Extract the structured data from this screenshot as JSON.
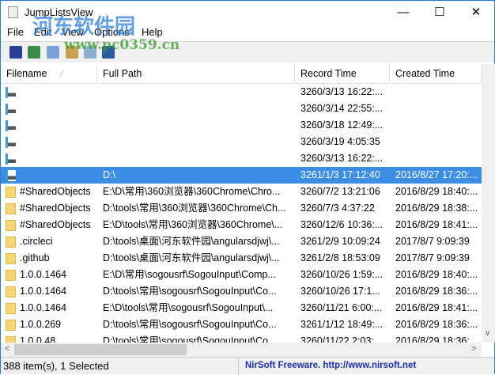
{
  "window": {
    "title": "JumpListsView",
    "minimize": "—",
    "maximize": "☐",
    "close": "✕"
  },
  "menu": [
    "File",
    "Edit",
    "View",
    "Options",
    "Help"
  ],
  "toolbar": [
    "save-icon",
    "refresh-icon",
    "copy-icon",
    "html-report-icon",
    "find-icon",
    "exit-icon"
  ],
  "columns": [
    "Filename",
    "Full Path",
    "Record Time",
    "Created Time"
  ],
  "rows": [
    {
      "type": "drive",
      "filename": "",
      "path": "",
      "record": "3260/3/13 16:22:...",
      "created": ""
    },
    {
      "type": "drive",
      "filename": "",
      "path": "",
      "record": "3260/3/14 22:55:...",
      "created": ""
    },
    {
      "type": "drive",
      "filename": "",
      "path": "",
      "record": "3260/3/18 12:49:...",
      "created": ""
    },
    {
      "type": "drive",
      "filename": "",
      "path": "",
      "record": "3260/3/19 4:05:35",
      "created": ""
    },
    {
      "type": "drive",
      "filename": "",
      "path": "",
      "record": "3260/3/13 16:22:...",
      "created": ""
    },
    {
      "type": "drive",
      "filename": "",
      "path": "D:\\",
      "record": "3261/1/3 17:12:40",
      "created": "2016/8/27 17:20:...",
      "selected": true
    },
    {
      "type": "folder",
      "filename": "#SharedObjects",
      "path": "E:\\D\\常用\\360浏览器\\360Chrome\\Chro...",
      "record": "3260/7/2 13:21:06",
      "created": "2016/8/29 18:40:..."
    },
    {
      "type": "folder",
      "filename": "#SharedObjects",
      "path": "D:\\tools\\常用\\360浏览器\\360Chrome\\Ch...",
      "record": "3260/7/3 4:37:22",
      "created": "2016/8/29 18:38:..."
    },
    {
      "type": "folder",
      "filename": "#SharedObjects",
      "path": "E:\\D\\tools\\常用\\360浏览器\\360Chrome\\...",
      "record": "3260/12/6 10:36:...",
      "created": "2016/8/29 18:41:..."
    },
    {
      "type": "folder",
      "filename": ".circleci",
      "path": "D:\\tools\\桌面\\河东软件园\\angularsdjwj\\...",
      "record": "3261/2/9 10:09:24",
      "created": "2017/8/7 9:09:39"
    },
    {
      "type": "folder",
      "filename": ".github",
      "path": "D:\\tools\\桌面\\河东软件园\\angularsdjwj\\...",
      "record": "3261/2/8 18:53:09",
      "created": "2017/8/7 9:09:39"
    },
    {
      "type": "folder",
      "filename": "1.0.0.1464",
      "path": "E:\\D\\常用\\sogousrf\\SogouInput\\Comp...",
      "record": "3260/10/26 1:59:...",
      "created": "2016/8/29 18:40:..."
    },
    {
      "type": "folder",
      "filename": "1.0.0.1464",
      "path": "D:\\tools\\常用\\sogousrf\\SogouInput\\Co...",
      "record": "3260/10/26 17:1...",
      "created": "2016/8/29 18:36:..."
    },
    {
      "type": "folder",
      "filename": "1.0.0.1464",
      "path": "E:\\D\\tools\\常用\\sogousrf\\SogouInput\\...",
      "record": "3260/11/21 6:00:...",
      "created": "2016/8/29 18:41:..."
    },
    {
      "type": "folder",
      "filename": "1.0.0.269",
      "path": "D:\\tools\\常用\\sogousrf\\SogouInput\\Co...",
      "record": "3261/1/12 18:49:...",
      "created": "2016/8/29 18:36:..."
    },
    {
      "type": "folder",
      "filename": "1.0.0.48",
      "path": "D:\\tools\\常用\\sogousrf\\SogouInput\\Co...",
      "record": "3260/11/22 2:03:...",
      "created": "2016/8/29 18:36:..."
    }
  ],
  "status": {
    "count": "388 item(s), 1 Selected",
    "credit": "NirSoft Freeware.  http://www.nirsoft.net"
  },
  "watermark": {
    "name": "河东软件园",
    "url": "www.pc0359.cn"
  }
}
